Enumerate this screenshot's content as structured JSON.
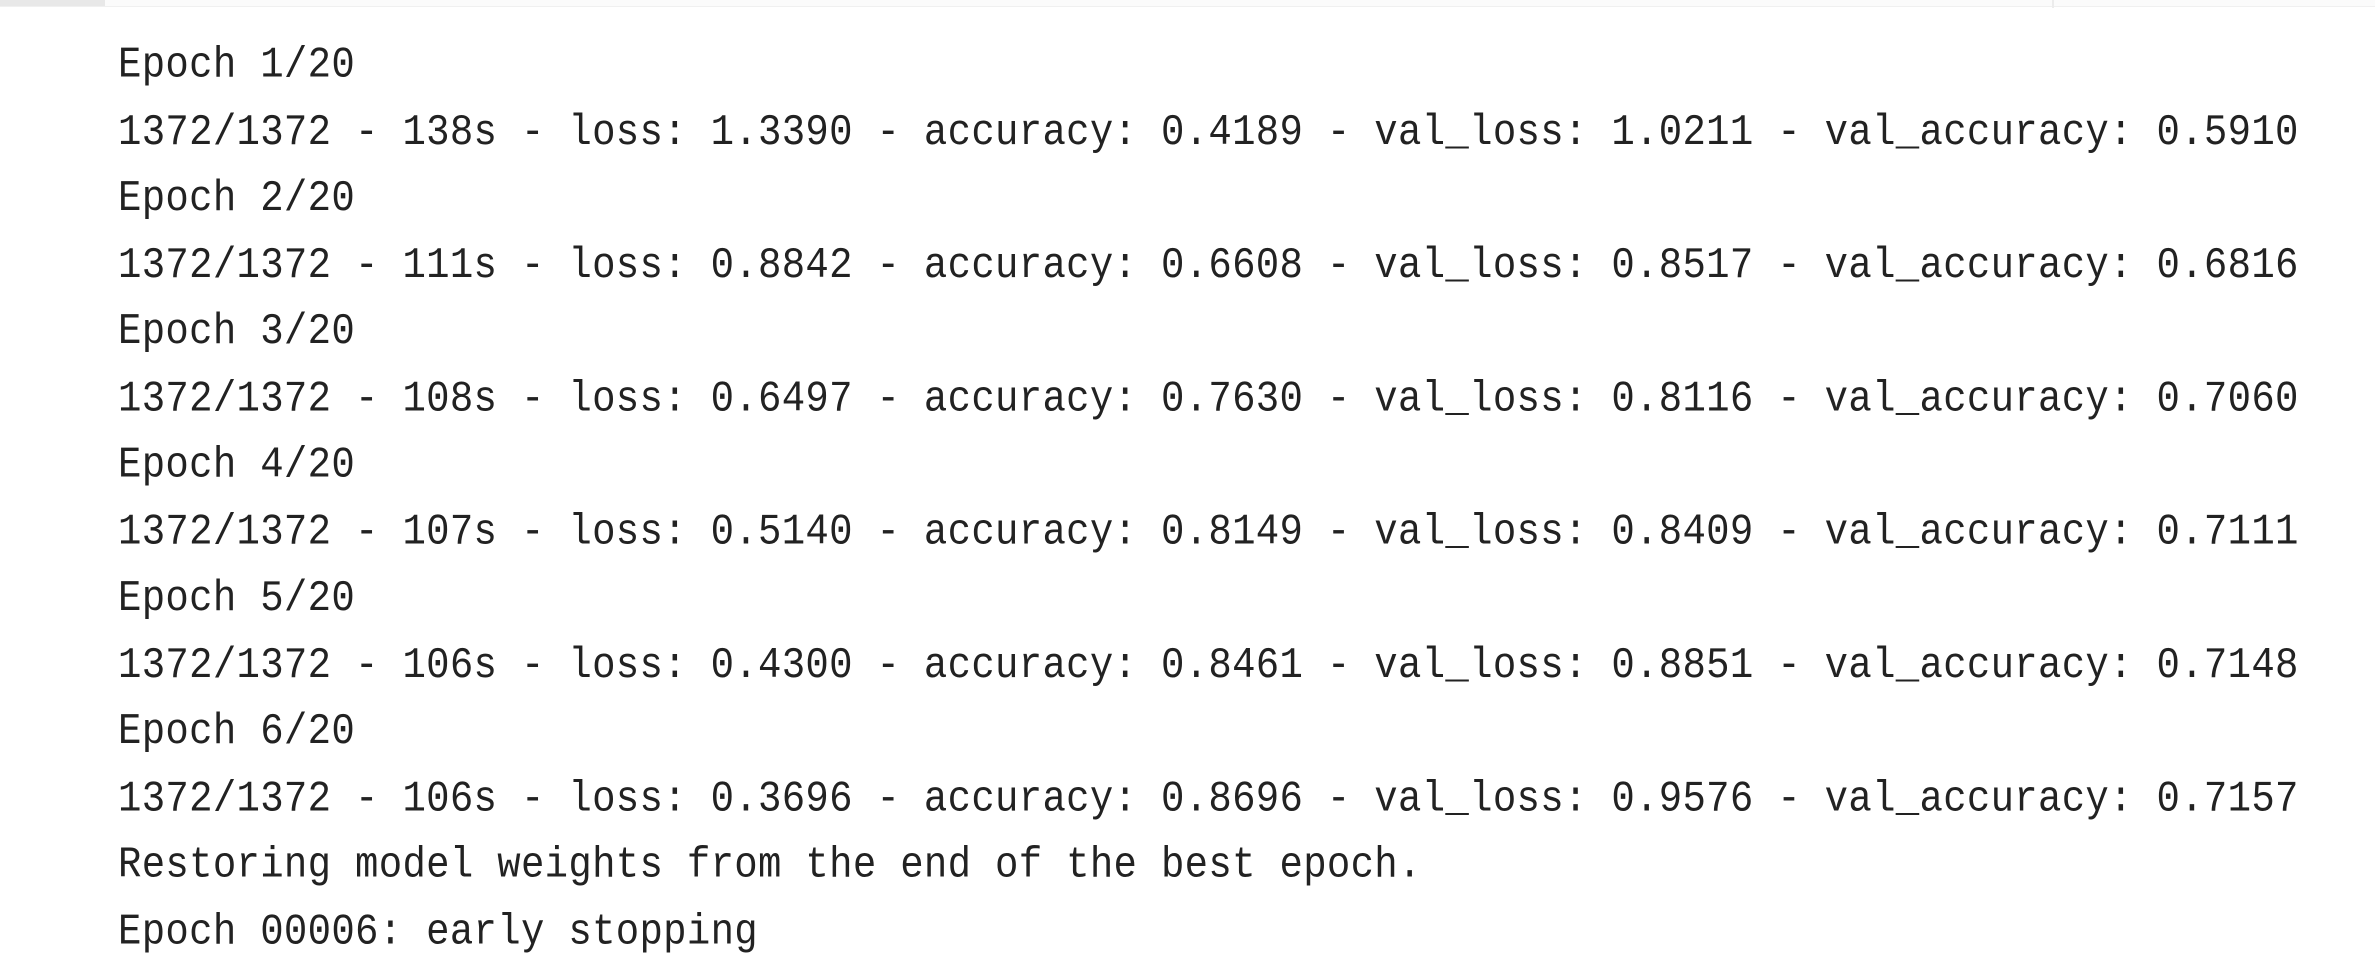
{
  "training_log": {
    "lines": [
      "Epoch 1/20",
      "1372/1372 - 138s - loss: 1.3390 - accuracy: 0.4189 - val_loss: 1.0211 - val_accuracy: 0.5910",
      "Epoch 2/20",
      "1372/1372 - 111s - loss: 0.8842 - accuracy: 0.6608 - val_loss: 0.8517 - val_accuracy: 0.6816",
      "Epoch 3/20",
      "1372/1372 - 108s - loss: 0.6497 - accuracy: 0.7630 - val_loss: 0.8116 - val_accuracy: 0.7060",
      "Epoch 4/20",
      "1372/1372 - 107s - loss: 0.5140 - accuracy: 0.8149 - val_loss: 0.8409 - val_accuracy: 0.7111",
      "Epoch 5/20",
      "1372/1372 - 106s - loss: 0.4300 - accuracy: 0.8461 - val_loss: 0.8851 - val_accuracy: 0.7148",
      "Epoch 6/20",
      "1372/1372 - 106s - loss: 0.3696 - accuracy: 0.8696 - val_loss: 0.9576 - val_accuracy: 0.7157",
      "Restoring model weights from the end of the best epoch.",
      "Epoch 00006: early stopping"
    ]
  }
}
